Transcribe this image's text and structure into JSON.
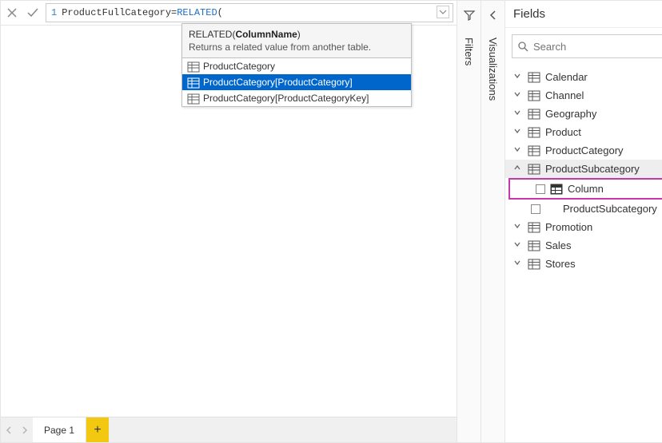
{
  "formula": {
    "lineNumber": "1",
    "name": "ProductFullCategory",
    "func": "RELATED",
    "open": "(",
    "tooltip": {
      "signature_prefix": "RELATED(",
      "signature_bold": "ColumnName",
      "signature_suffix": ")",
      "description": "Returns a related value from another table."
    },
    "suggestions": [
      {
        "label": "ProductCategory",
        "selected": false
      },
      {
        "label": "ProductCategory[ProductCategory]",
        "selected": true
      },
      {
        "label": "ProductCategory[ProductCategoryKey]",
        "selected": false
      }
    ]
  },
  "tabs": {
    "page1": "Page 1",
    "add": "+"
  },
  "rails": {
    "filters": "Filters",
    "visualizations": "Visualizations"
  },
  "fields": {
    "title": "Fields",
    "search_placeholder": "Search",
    "tables": [
      {
        "name": "Calendar",
        "expanded": false
      },
      {
        "name": "Channel",
        "expanded": false
      },
      {
        "name": "Geography",
        "expanded": false
      },
      {
        "name": "Product",
        "expanded": false
      },
      {
        "name": "ProductCategory",
        "expanded": false
      },
      {
        "name": "ProductSubcategory",
        "expanded": true,
        "columns": [
          {
            "name": "Column",
            "highlight": true,
            "iconkind": "calc"
          },
          {
            "name": "ProductSubcategory",
            "highlight": false,
            "iconkind": ""
          }
        ]
      },
      {
        "name": "Promotion",
        "expanded": false
      },
      {
        "name": "Sales",
        "expanded": false
      },
      {
        "name": "Stores",
        "expanded": false
      }
    ]
  }
}
